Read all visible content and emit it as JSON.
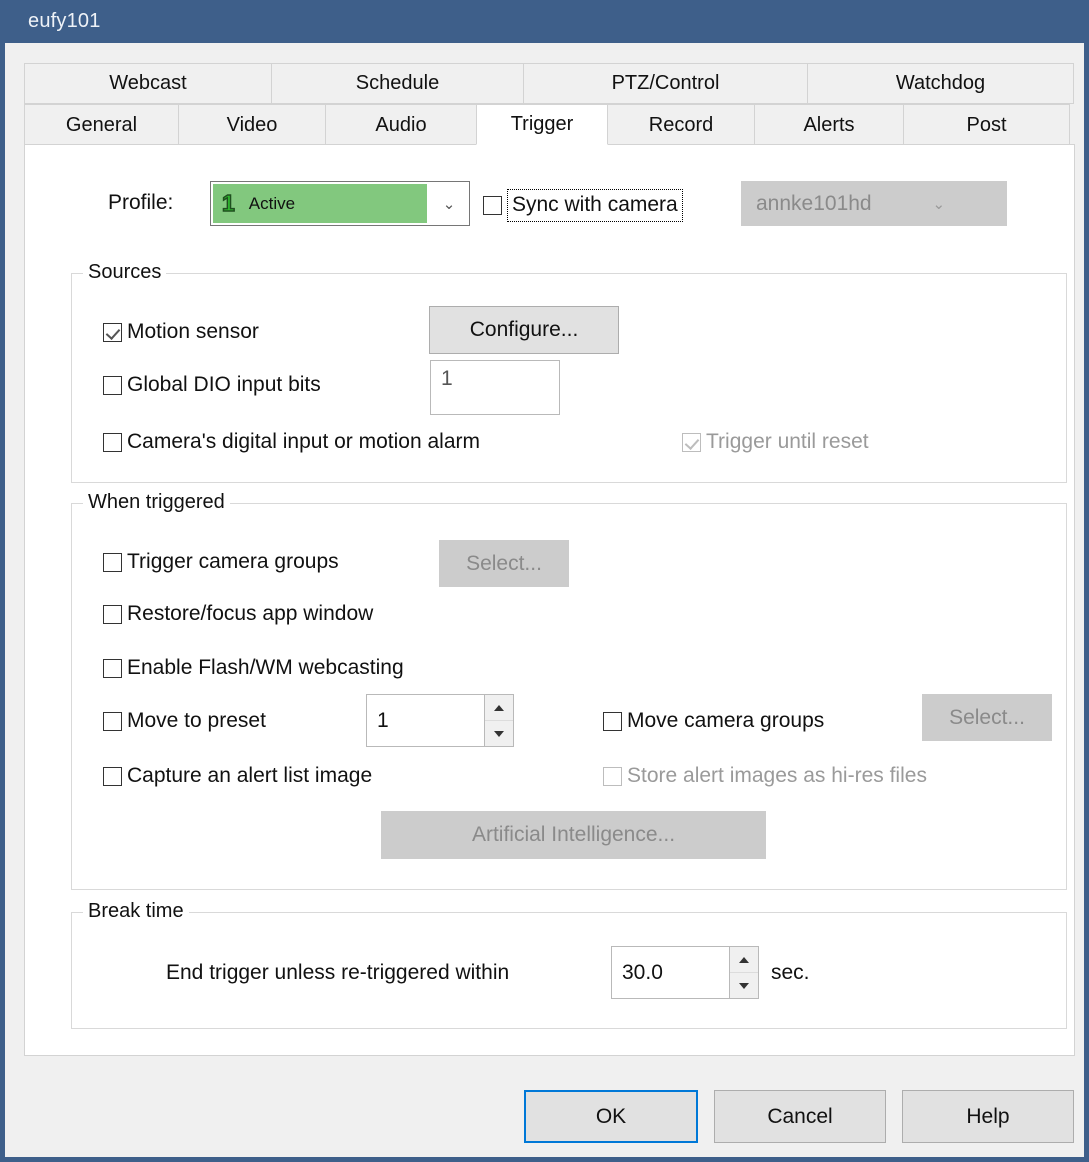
{
  "window": {
    "title": "eufy101"
  },
  "tabs": {
    "row_top": [
      {
        "label": "Webcast",
        "selected": false
      },
      {
        "label": "Schedule",
        "selected": false
      },
      {
        "label": "PTZ/Control",
        "selected": false
      },
      {
        "label": "Watchdog",
        "selected": false
      }
    ],
    "row_bottom": [
      {
        "label": "General",
        "selected": false
      },
      {
        "label": "Video",
        "selected": false
      },
      {
        "label": "Audio",
        "selected": false
      },
      {
        "label": "Trigger",
        "selected": true
      },
      {
        "label": "Record",
        "selected": false
      },
      {
        "label": "Alerts",
        "selected": false
      },
      {
        "label": "Post",
        "selected": false
      }
    ]
  },
  "profile": {
    "label": "Profile:",
    "number": "1",
    "value": "Active",
    "highlight_color": "#82c87e",
    "sync_checkbox": {
      "label": "Sync with camera",
      "checked": false,
      "focused": true
    },
    "camera_combo": {
      "value": "annke101hd",
      "enabled": false
    }
  },
  "sources": {
    "legend": "Sources",
    "motion_sensor": {
      "label": "Motion sensor",
      "checked": true
    },
    "configure_button": {
      "label": "Configure...",
      "enabled": true
    },
    "global_dio": {
      "label": "Global DIO input bits",
      "checked": false
    },
    "dio_value": "1",
    "camera_digital_input": {
      "label": "Camera's digital input or motion alarm",
      "checked": false
    },
    "trigger_until_reset": {
      "label": "Trigger until reset",
      "checked": true,
      "enabled": false
    }
  },
  "when_triggered": {
    "legend": "When triggered",
    "trigger_camera_groups": {
      "label": "Trigger camera groups",
      "checked": false
    },
    "select_groups_button": {
      "label": "Select...",
      "enabled": false
    },
    "restore_focus": {
      "label": "Restore/focus app window",
      "checked": false
    },
    "enable_webcasting": {
      "label": "Enable Flash/WM webcasting",
      "checked": false
    },
    "move_to_preset": {
      "label": "Move to preset",
      "checked": false
    },
    "preset_value": "1",
    "move_camera_groups": {
      "label": "Move camera groups",
      "checked": false
    },
    "select_move_button": {
      "label": "Select...",
      "enabled": false
    },
    "capture_alert_image": {
      "label": "Capture an alert list image",
      "checked": false
    },
    "store_hires": {
      "label": "Store alert images as hi-res files",
      "checked": false,
      "enabled": false
    },
    "ai_button": {
      "label": "Artificial Intelligence...",
      "enabled": false
    }
  },
  "break_time": {
    "legend": "Break time",
    "label": "End trigger unless re-triggered within",
    "value": "30.0",
    "unit": "sec."
  },
  "footer": {
    "ok": "OK",
    "cancel": "Cancel",
    "help": "Help",
    "focus_color": "#0078d7"
  }
}
